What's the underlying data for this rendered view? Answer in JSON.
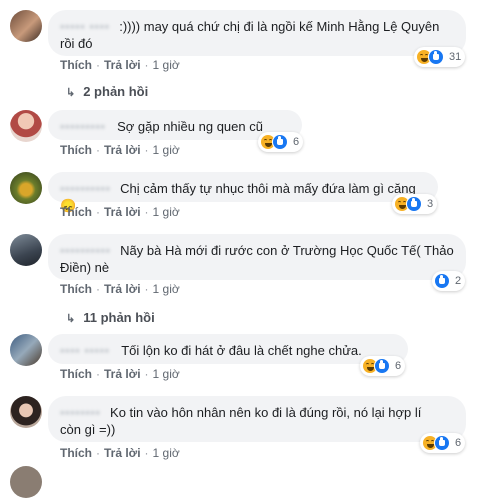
{
  "comments": [
    {
      "name": "••••• ••••",
      "text": ":)))) may quá chứ chị đi là ngồi kế Minh Hằng Lệ Quyên",
      "text2": "rồi đó",
      "like": "Thích",
      "reply": "Trả lời",
      "time": "1 giờ",
      "reactions": [
        "haha",
        "like"
      ],
      "count": "31"
    },
    {
      "name": "•••••••••",
      "text": "Sợ gặp nhiều ng quen cũ",
      "like": "Thích",
      "reply": "Trả lời",
      "time": "1 giờ",
      "reactions": [
        "haha",
        "like"
      ],
      "count": "6"
    },
    {
      "name": "••••••••••",
      "text": "Chị cảm thấy tự nhục thôi mà mấy đứa làm gì căng 😞",
      "like": "Thích",
      "reply": "Trả lời",
      "time": "1 giờ",
      "reactions": [
        "haha",
        "like"
      ],
      "count": "3"
    },
    {
      "name": "••••••••••",
      "text": "Nãy bà Hà mới đi rước con ở Trường Học Quốc Tế( Thảo",
      "text2": "Điền) nè",
      "like": "Thích",
      "reply": "Trả lời",
      "time": "1 giờ",
      "reactions": [
        "like"
      ],
      "count": "2"
    },
    {
      "name": "•••• •••••",
      "text": "Tối lộn ko đi hát ở đâu là chết nghe chửa.",
      "like": "Thích",
      "reply": "Trả lời",
      "time": "1 giờ",
      "reactions": [
        "haha",
        "like"
      ],
      "count": "6"
    },
    {
      "name": "••••••••",
      "text": "Ko tin vào hôn nhân nên ko đi là đúng rồi, nó lại hợp lí",
      "text2": "còn gì =))",
      "like": "Thích",
      "reply": "Trả lời",
      "time": "1 giờ",
      "reactions": [
        "haha",
        "like"
      ],
      "count": "6"
    }
  ],
  "replies": [
    {
      "label": "2 phản hồi"
    },
    {
      "label": "11 phản hồi"
    }
  ],
  "colors": {
    "bubble": "#f2f3f5",
    "link": "#606770",
    "like": "#1877f2",
    "haha": "#f7b125"
  }
}
